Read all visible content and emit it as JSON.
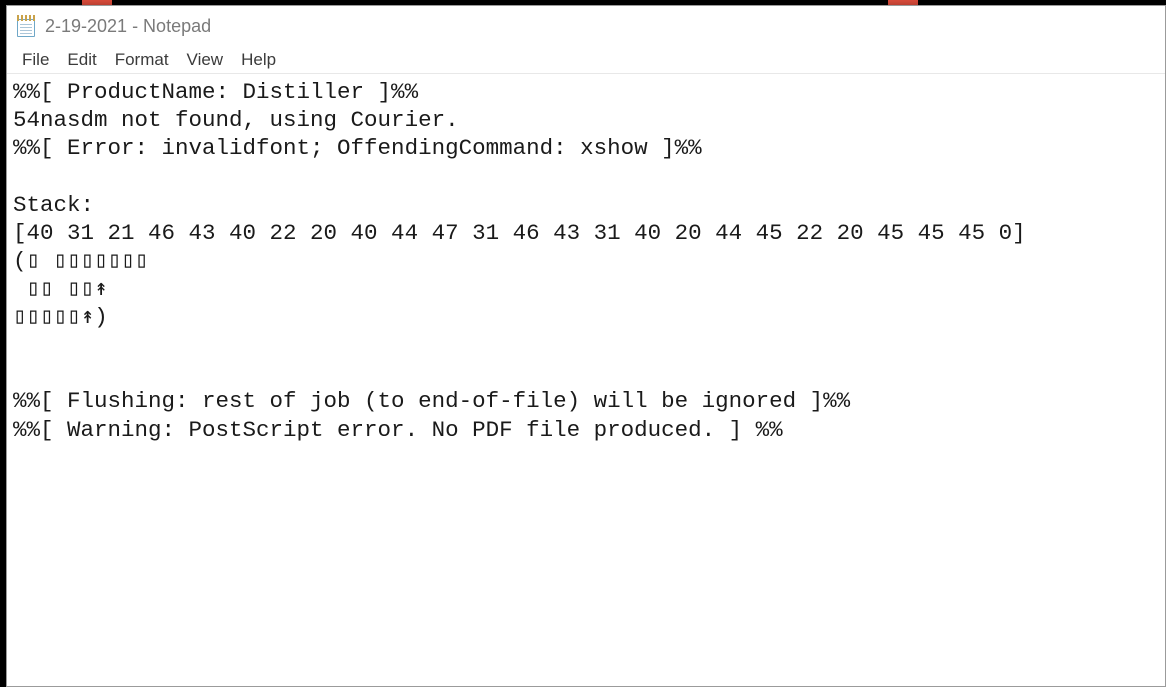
{
  "window": {
    "title": "2-19-2021 - Notepad"
  },
  "menubar": {
    "items": [
      "File",
      "Edit",
      "Format",
      "View",
      "Help"
    ]
  },
  "content": {
    "lines": [
      "%%[ ProductName: Distiller ]%%",
      "54nasdm not found, using Courier.",
      "%%[ Error: invalidfont; OffendingCommand: xshow ]%%",
      "",
      "Stack:",
      "[40 31 21 46 43 40 22 20 40 44 47 31 46 43 31 40 20 44 45 22 20 45 45 45 0]",
      "(▯ ▯▯▯▯▯▯▯",
      " ▯▯ ▯▯↟",
      "▯▯▯▯▯↟)",
      "",
      "",
      "%%[ Flushing: rest of job (to end-of-file) will be ignored ]%%",
      "%%[ Warning: PostScript error. No PDF file produced. ] %%"
    ]
  }
}
